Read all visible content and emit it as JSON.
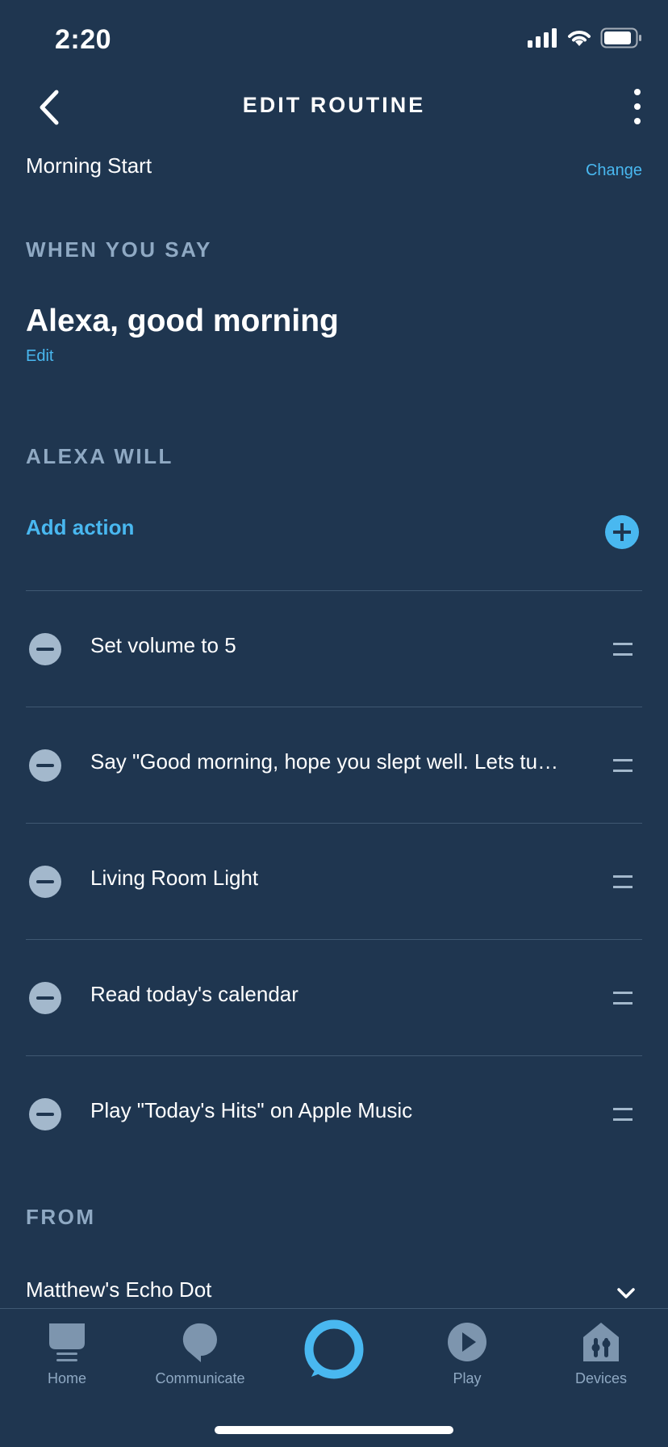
{
  "status_bar": {
    "time": "2:20"
  },
  "header": {
    "title": "EDIT ROUTINE"
  },
  "routine": {
    "name": "Morning Start",
    "change_label": "Change"
  },
  "when_you_say": {
    "section_label": "WHEN YOU SAY",
    "phrase": "Alexa, good morning",
    "edit_label": "Edit"
  },
  "alexa_will": {
    "section_label": "ALEXA WILL",
    "add_action_label": "Add action",
    "actions": [
      {
        "label": "Set volume to 5"
      },
      {
        "label": "Say \"Good morning, hope you slept well. Lets tu…"
      },
      {
        "label": "Living Room Light"
      },
      {
        "label": "Read today's calendar"
      },
      {
        "label": "Play \"Today's Hits\" on Apple Music"
      }
    ]
  },
  "from": {
    "section_label": "FROM",
    "device": "Matthew's Echo Dot"
  },
  "bottom_nav": {
    "items": [
      {
        "label": "Home",
        "icon": "home-icon"
      },
      {
        "label": "Communicate",
        "icon": "communicate-icon"
      },
      {
        "label": "",
        "icon": "alexa-icon"
      },
      {
        "label": "Play",
        "icon": "play-icon"
      },
      {
        "label": "Devices",
        "icon": "devices-icon"
      }
    ]
  },
  "colors": {
    "background": "#1f3650",
    "accent": "#49b8f0",
    "muted": "#8fa9c3",
    "divider": "#3f5872"
  }
}
